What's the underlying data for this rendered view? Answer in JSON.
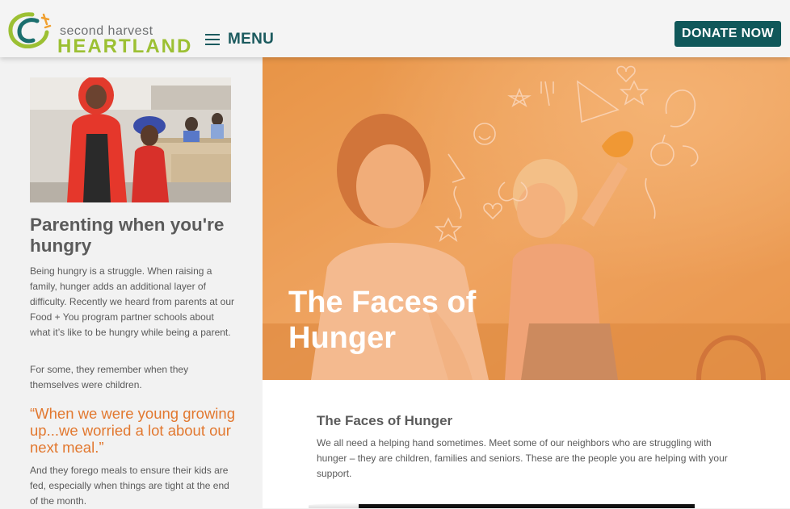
{
  "header": {
    "logo_line1": "second harvest",
    "logo_line2": "HEARTLAND",
    "menu_label": "MENU",
    "donate_label": "DONATE NOW"
  },
  "sidebar": {
    "title": "Parenting when you're hungry",
    "para1": "Being hungry is a struggle. When raising a family, hunger adds an additional layer of difficulty. Recently we heard from parents at our Food + You program partner schools about what it’s like to be hungry while being a parent.",
    "para2": "For some, they remember when they themselves were children.",
    "quote": "“When we were young growing up...we worried a lot about our next meal.”",
    "para3": "And they forego meals to ensure their kids are fed, especially when things are tight at the end of the month."
  },
  "hero": {
    "title": "The Faces of Hunger"
  },
  "content": {
    "title": "The Faces of Hunger",
    "body": "We all need a helping hand sometimes. Meet some of our neighbors who are struggling with hunger – they are children, families and seniors. These are the people you are helping with your support."
  },
  "colors": {
    "brand_teal": "#10585a",
    "brand_green": "#9cc033",
    "accent_orange": "#e2782f",
    "hero_overlay": "#f08a3c"
  }
}
